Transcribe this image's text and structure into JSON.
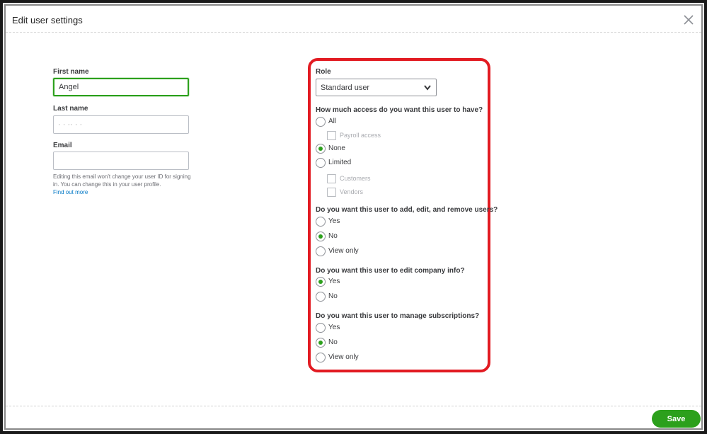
{
  "dialog": {
    "title": "Edit user settings",
    "close_icon": "close-icon"
  },
  "form": {
    "first_name_label": "First name",
    "first_name_value": "Angel",
    "last_name_label": "Last name",
    "last_name_value": "· · ·· · ·",
    "email_label": "Email",
    "email_value": "",
    "email_help": "Editing this email won't change your user ID for signing in. You can change this in your user profile.",
    "email_help_link": "Find out more"
  },
  "permissions": {
    "role_label": "Role",
    "role_value": "Standard user",
    "access_question": "How much access do you want this user to have?",
    "access_options": {
      "all": "All",
      "payroll": "Payroll access",
      "none": "None",
      "limited": "Limited",
      "customers": "Customers",
      "vendors": "Vendors"
    },
    "access_selected": "None",
    "users_question": "Do you want this user to add, edit, and remove users?",
    "users_options": {
      "yes": "Yes",
      "no": "No",
      "view_only": "View only"
    },
    "users_selected": "No",
    "company_question": "Do you want this user to edit company info?",
    "company_options": {
      "yes": "Yes",
      "no": "No"
    },
    "company_selected": "Yes",
    "subscriptions_question": "Do you want this user to manage subscriptions?",
    "subscriptions_options": {
      "yes": "Yes",
      "no": "No",
      "view_only": "View only"
    },
    "subscriptions_selected": "No"
  },
  "footer": {
    "save_label": "Save"
  },
  "colors": {
    "accent": "#2ca01c",
    "highlight": "#e21b22",
    "link": "#0077c5"
  }
}
